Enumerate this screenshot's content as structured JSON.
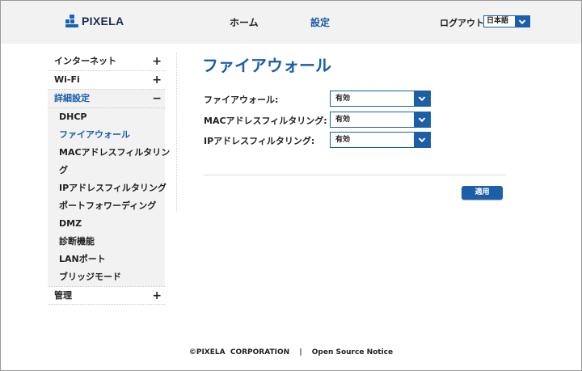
{
  "header": {
    "logo_text": "PIXELA",
    "nav": {
      "home": "ホーム",
      "settings": "設定"
    },
    "logout": "ログアウト",
    "language": "日本語"
  },
  "sidebar": {
    "items": [
      {
        "label": "インターネット",
        "sign": "+"
      },
      {
        "label": "Wi-Fi",
        "sign": "+"
      },
      {
        "label": "詳細設定",
        "sign": "−"
      }
    ],
    "sub_items": [
      "DHCP",
      "ファイアウォール",
      "MACアドレスフィルタリン",
      "グ",
      "IPアドレスフィルタリング",
      "ポートフォワーディング",
      "DMZ",
      "診断機能",
      "LANポート",
      "ブリッジモード"
    ],
    "selected_sub": "ファイアウォール",
    "last_item": {
      "label": "管理",
      "sign": "+"
    }
  },
  "main": {
    "title": "ファイアウォール",
    "rows": [
      {
        "label": "ファイアウォール:",
        "value": "有効"
      },
      {
        "label": "MACアドレスフィルタリング:",
        "value": "有効"
      },
      {
        "label": "IPアドレスフィルタリング:",
        "value": "有効"
      }
    ],
    "apply": "適用"
  },
  "footer": {
    "copyright": "©PIXELA  CORPORATION",
    "separator": "|",
    "notice": "Open Source Notice"
  },
  "colors": {
    "accent": "#1b5fa6",
    "header_bg": "#f2f2f2",
    "active_text": "#1a5fa8"
  }
}
